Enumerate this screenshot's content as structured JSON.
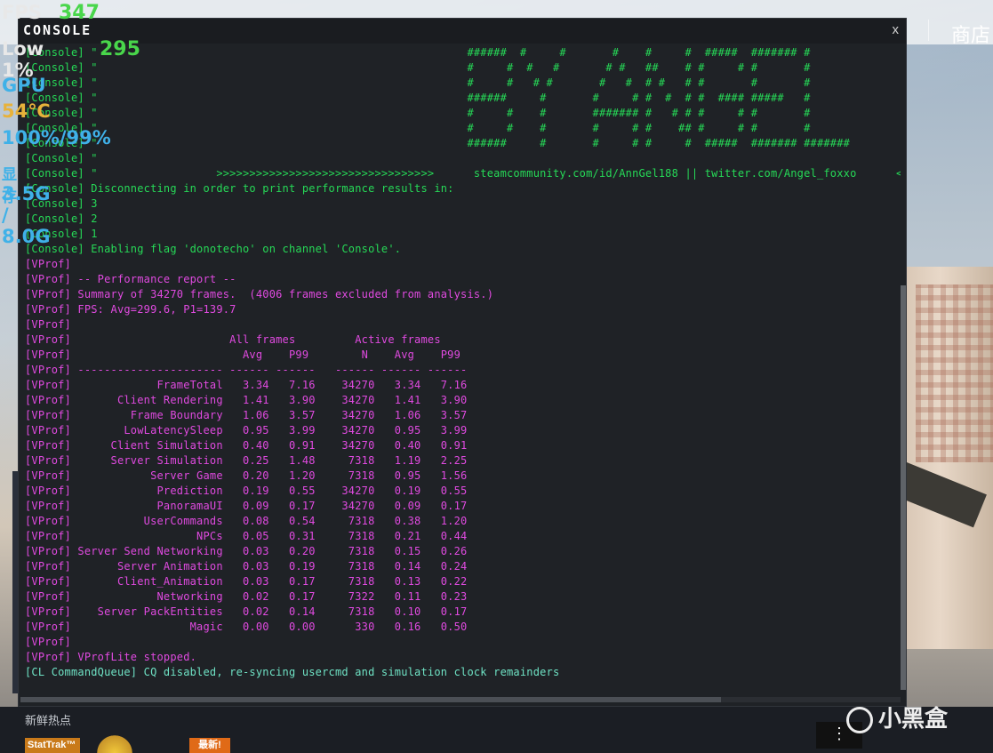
{
  "hud": {
    "fps_label": "FPS",
    "fps_value": "347",
    "low_label": "Low 1%",
    "low_value": "295",
    "gpu_label": "GPU",
    "gpu_temp": "54℃",
    "gpu_util": "100%/99%",
    "vram_label": "显存",
    "vram_value": "3.5G / 8.0G"
  },
  "background": {
    "shop_label": "商店",
    "bottom_text": "新鲜热点",
    "stattrak": "StatTrak™",
    "new_badge": "最新!",
    "more_button": "⋮",
    "watermark": "小黑盒"
  },
  "console": {
    "title": "CONSOLE",
    "close_label": "x",
    "colors": {
      "green": "#26d957",
      "magenta": "#e04ae0",
      "cyan": "#6fe3c5",
      "background": "#1f2226"
    },
    "lines": [
      {
        "color": "green",
        "text": "[Console] \"                                                        ######  #     #       #    #     #  #####  ####### #"
      },
      {
        "color": "green",
        "text": "[Console] \"                                                        #     #  #   #       # #   ##    # #     # #       #"
      },
      {
        "color": "green",
        "text": "[Console] \"                                                        #     #   # #       #   #  # #   # #       #       #"
      },
      {
        "color": "green",
        "text": "[Console] \"                                                        ######     #       #     # #  #  # #  #### #####   #"
      },
      {
        "color": "green",
        "text": "[Console] \"                                                        #     #    #       ####### #   # # #     # #       #"
      },
      {
        "color": "green",
        "text": "[Console] \"                                                        #     #    #       #     # #    ## #     # #       #"
      },
      {
        "color": "green",
        "text": "[Console] \"                                                        ######     #       #     # #     #  #####  ####### #######"
      },
      {
        "color": "green",
        "text": "[Console] \""
      },
      {
        "color": "green",
        "text": "[Console] \"                  >>>>>>>>>>>>>>>>>>>>>>>>>>>>>>>>>      steamcommunity.com/id/AnnGel188 || twitter.com/Angel_foxxo      <<<<<<<<<<<<<<<<"
      },
      {
        "color": "green",
        "text": "[Console] Disconnecting in order to print performance results in:"
      },
      {
        "color": "green",
        "text": "[Console] 3"
      },
      {
        "color": "green",
        "text": "[Console] 2"
      },
      {
        "color": "green",
        "text": "[Console] 1"
      },
      {
        "color": "green",
        "text": "[Console] Enabling flag 'donotecho' on channel 'Console'."
      },
      {
        "color": "magenta",
        "text": "[VProf]"
      },
      {
        "color": "magenta",
        "text": "[VProf] -- Performance report --"
      },
      {
        "color": "magenta",
        "text": "[VProf] Summary of 34270 frames.  (4006 frames excluded from analysis.)"
      },
      {
        "color": "magenta",
        "text": "[VProf] FPS: Avg=299.6, P1=139.7"
      },
      {
        "color": "magenta",
        "text": "[VProf]"
      },
      {
        "color": "magenta",
        "text": "[VProf]                        All frames         Active frames"
      },
      {
        "color": "magenta",
        "text": "[VProf]                          Avg    P99        N    Avg    P99"
      },
      {
        "color": "magenta",
        "text": "[VProf] ---------------------- ------ ------   ------ ------ ------"
      },
      {
        "color": "magenta",
        "text": "[VProf]             FrameTotal   3.34   7.16    34270   3.34   7.16"
      },
      {
        "color": "magenta",
        "text": "[VProf]       Client Rendering   1.41   3.90    34270   1.41   3.90"
      },
      {
        "color": "magenta",
        "text": "[VProf]         Frame Boundary   1.06   3.57    34270   1.06   3.57"
      },
      {
        "color": "magenta",
        "text": "[VProf]        LowLatencySleep   0.95   3.99    34270   0.95   3.99"
      },
      {
        "color": "magenta",
        "text": "[VProf]      Client Simulation   0.40   0.91    34270   0.40   0.91"
      },
      {
        "color": "magenta",
        "text": "[VProf]      Server Simulation   0.25   1.48     7318   1.19   2.25"
      },
      {
        "color": "magenta",
        "text": "[VProf]            Server Game   0.20   1.20     7318   0.95   1.56"
      },
      {
        "color": "magenta",
        "text": "[VProf]             Prediction   0.19   0.55    34270   0.19   0.55"
      },
      {
        "color": "magenta",
        "text": "[VProf]             PanoramaUI   0.09   0.17    34270   0.09   0.17"
      },
      {
        "color": "magenta",
        "text": "[VProf]           UserCommands   0.08   0.54     7318   0.38   1.20"
      },
      {
        "color": "magenta",
        "text": "[VProf]                   NPCs   0.05   0.31     7318   0.21   0.44"
      },
      {
        "color": "magenta",
        "text": "[VProf] Server Send Networking   0.03   0.20     7318   0.15   0.26"
      },
      {
        "color": "magenta",
        "text": "[VProf]       Server Animation   0.03   0.19     7318   0.14   0.24"
      },
      {
        "color": "magenta",
        "text": "[VProf]       Client_Animation   0.03   0.17     7318   0.13   0.22"
      },
      {
        "color": "magenta",
        "text": "[VProf]             Networking   0.02   0.17     7322   0.11   0.23"
      },
      {
        "color": "magenta",
        "text": "[VProf]    Server PackEntities   0.02   0.14     7318   0.10   0.17"
      },
      {
        "color": "magenta",
        "text": "[VProf]                  Magic   0.00   0.00      330   0.16   0.50"
      },
      {
        "color": "magenta",
        "text": "[VProf]"
      },
      {
        "color": "magenta",
        "text": "[VProf] VProfLite stopped."
      },
      {
        "color": "cyan",
        "text": "[CL CommandQueue] CQ disabled, re-syncing usercmd and simulation clock remainders"
      }
    ]
  }
}
